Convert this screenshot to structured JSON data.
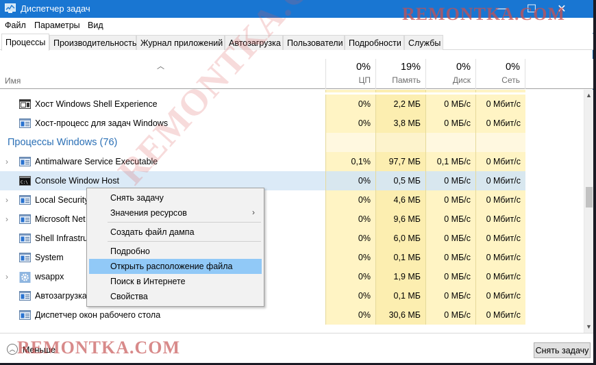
{
  "window": {
    "title": "Диспетчер задач",
    "controls": {
      "minimize": "—",
      "maximize": "☐",
      "close": "✕"
    }
  },
  "menu": [
    "Файл",
    "Параметры",
    "Вид"
  ],
  "tabs": [
    {
      "label": "Процессы",
      "active": true
    },
    {
      "label": "Производительность"
    },
    {
      "label": "Журнал приложений"
    },
    {
      "label": "Автозагрузка"
    },
    {
      "label": "Пользователи"
    },
    {
      "label": "Подробности"
    },
    {
      "label": "Службы"
    }
  ],
  "columns": {
    "name": "Имя",
    "cpu": {
      "pct": "0%",
      "label": "ЦП"
    },
    "memory": {
      "pct": "19%",
      "label": "Память"
    },
    "disk": {
      "pct": "0%",
      "label": "Диск"
    },
    "network": {
      "pct": "0%",
      "label": "Сеть"
    }
  },
  "rows": [
    {
      "name": "Хост Windows Shell Experience",
      "icon": "shell-window-icon",
      "expandable": false,
      "cpu": "0%",
      "mem": "2,2 МБ",
      "disk": "0 МБ/с",
      "net": "0 Мбит/с"
    },
    {
      "name": "Хост-процесс для задач Windows",
      "icon": "process-window-icon",
      "expandable": false,
      "cpu": "0%",
      "mem": "3,8 МБ",
      "disk": "0 МБ/с",
      "net": "0 Мбит/с"
    },
    {
      "group": "Процессы Windows (76)"
    },
    {
      "name": "Antimalware Service Executable",
      "icon": "process-window-icon",
      "expandable": true,
      "cpu": "0,1%",
      "mem": "97,7 МБ",
      "disk": "0,1 МБ/с",
      "net": "0 Мбит/с"
    },
    {
      "name": "Console Window Host",
      "icon": "console-icon",
      "expandable": false,
      "selected": true,
      "cpu": "0%",
      "mem": "0,5 МБ",
      "disk": "0 МБ/с",
      "net": "0 Мбит/с"
    },
    {
      "name": "Local Security",
      "icon": "process-window-icon",
      "expandable": true,
      "cpu": "0%",
      "mem": "4,6 МБ",
      "disk": "0 МБ/с",
      "net": "0 Мбит/с"
    },
    {
      "name": "Microsoft Net",
      "icon": "process-window-icon",
      "expandable": true,
      "cpu": "0%",
      "mem": "9,6 МБ",
      "disk": "0 МБ/с",
      "net": "0 Мбит/с"
    },
    {
      "name": "Shell Infrastruc",
      "icon": "process-window-icon",
      "expandable": false,
      "cpu": "0%",
      "mem": "6,0 МБ",
      "disk": "0 МБ/с",
      "net": "0 Мбит/с"
    },
    {
      "name": "System",
      "icon": "process-window-icon",
      "expandable": false,
      "cpu": "0%",
      "mem": "0,1 МБ",
      "disk": "0 МБ/с",
      "net": "0 Мбит/с"
    },
    {
      "name": "wsappx",
      "icon": "gear-icon",
      "expandable": true,
      "cpu": "0%",
      "mem": "1,9 МБ",
      "disk": "0 МБ/с",
      "net": "0 Мбит/с"
    },
    {
      "name": "Автозагрузка",
      "icon": "process-window-icon",
      "expandable": false,
      "cpu": "0%",
      "mem": "0,1 МБ",
      "disk": "0 МБ/с",
      "net": "0 Мбит/с"
    },
    {
      "name": "Диспетчер окон рабочего стола",
      "icon": "process-window-icon",
      "expandable": false,
      "cpu": "0%",
      "mem": "30,6 МБ",
      "disk": "0 МБ/с",
      "net": "0 Мбит/с"
    }
  ],
  "context_menu": {
    "items": [
      {
        "label": "Снять задачу"
      },
      {
        "label": "Значения ресурсов",
        "submenu": true
      },
      {
        "separator": true
      },
      {
        "label": "Создать файл дампа"
      },
      {
        "separator": true
      },
      {
        "label": "Подробно"
      },
      {
        "label": "Открыть расположение файла",
        "highlighted": true
      },
      {
        "label": "Поиск в Интернете"
      },
      {
        "label": "Свойства"
      }
    ]
  },
  "footer": {
    "less_label": "Меньше",
    "end_task_label": "Снять задачу"
  },
  "watermark": "REMONTKA.COM",
  "colors": {
    "titlebar": "#1976d2",
    "heat_light": "#fff4c4",
    "heat_mem": "#fceeb0",
    "selection": "#dbeaf7",
    "menu_highlight": "#91c9f7",
    "group_text": "#2a6fb5"
  }
}
